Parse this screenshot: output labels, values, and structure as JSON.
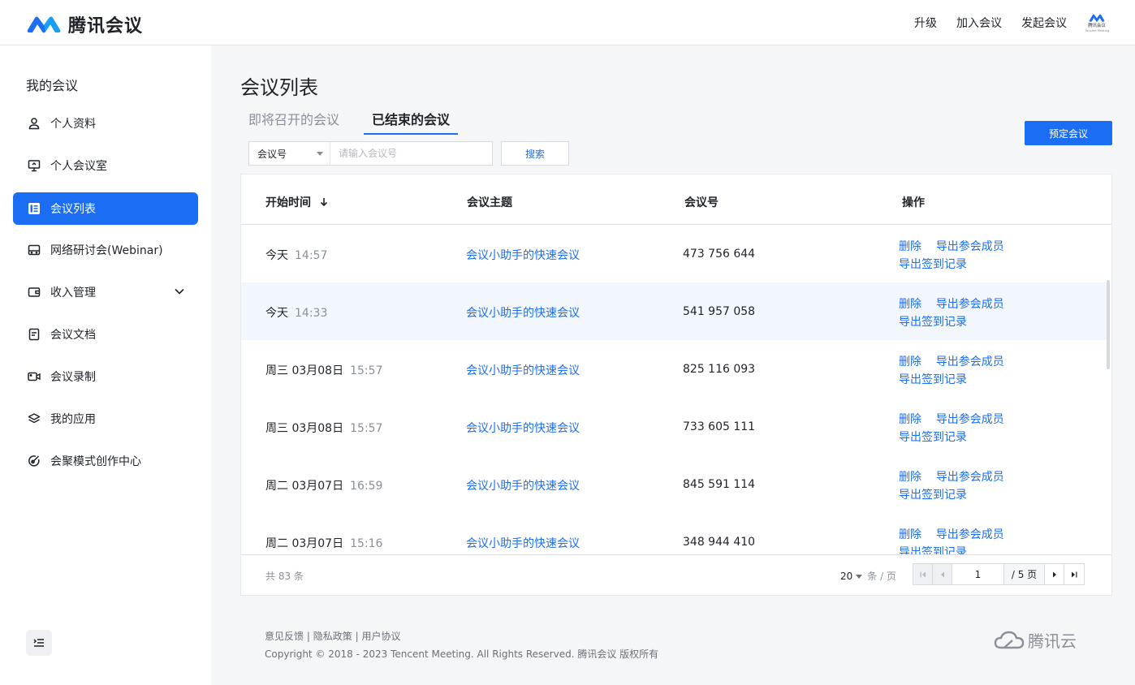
{
  "app": {
    "brand": "腾讯会议",
    "avatar_text": "腾讯会议",
    "avatar_sub": "Tencent Meeting"
  },
  "topnav": {
    "upgrade": "升级",
    "join": "加入会议",
    "start": "发起会议"
  },
  "sidebar": {
    "title": "我的会议",
    "items": [
      {
        "label": "个人资料",
        "icon": "person-icon"
      },
      {
        "label": "个人会议室",
        "icon": "monitor-icon"
      },
      {
        "label": "会议列表",
        "icon": "list-icon"
      },
      {
        "label": "网络研讨会(Webinar)",
        "icon": "webinar-icon"
      },
      {
        "label": "收入管理",
        "icon": "wallet-icon"
      },
      {
        "label": "会议文档",
        "icon": "document-icon"
      },
      {
        "label": "会议录制",
        "icon": "video-icon"
      },
      {
        "label": "我的应用",
        "icon": "layers-icon"
      },
      {
        "label": "会聚模式创作中心",
        "icon": "create-icon"
      }
    ],
    "active_index": 2
  },
  "main": {
    "title": "会议列表",
    "tabs": [
      {
        "label": "即将召开的会议"
      },
      {
        "label": "已结束的会议"
      }
    ],
    "active_tab": 1,
    "book_button": "预定会议",
    "search": {
      "select_value": "会议号",
      "placeholder": "请输入会议号",
      "button": "搜索"
    }
  },
  "table": {
    "headers": {
      "time": "开始时间",
      "topic": "会议主题",
      "number": "会议号",
      "ops": "操作"
    },
    "sort_icon": "arrow-down-icon",
    "rows": [
      {
        "day": "今天",
        "time": "14:57",
        "topic": "会议小助手的快速会议",
        "number": "473 756 644",
        "op_delete": "删除",
        "op_export_members": "导出参会成员",
        "op_export_signin": "导出签到记录"
      },
      {
        "day": "今天",
        "time": "14:33",
        "topic": "会议小助手的快速会议",
        "number": "541 957 058",
        "op_delete": "删除",
        "op_export_members": "导出参会成员",
        "op_export_signin": "导出签到记录"
      },
      {
        "day": "周三 03月08日",
        "time": "15:57",
        "topic": "会议小助手的快速会议",
        "number": "825 116 093",
        "op_delete": "删除",
        "op_export_members": "导出参会成员",
        "op_export_signin": "导出签到记录"
      },
      {
        "day": "周三 03月08日",
        "time": "15:57",
        "topic": "会议小助手的快速会议",
        "number": "733 605 111",
        "op_delete": "删除",
        "op_export_members": "导出参会成员",
        "op_export_signin": "导出签到记录"
      },
      {
        "day": "周二 03月07日",
        "time": "16:59",
        "topic": "会议小助手的快速会议",
        "number": "845 591 114",
        "op_delete": "删除",
        "op_export_members": "导出参会成员",
        "op_export_signin": "导出签到记录"
      },
      {
        "day": "周二 03月07日",
        "time": "15:16",
        "topic": "会议小助手的快速会议",
        "number": "348 944 410",
        "op_delete": "删除",
        "op_export_members": "导出参会成员",
        "op_export_signin": "导出签到记录"
      }
    ],
    "highlighted_row": 1
  },
  "pagination": {
    "total_text": "共 83 条",
    "page_size": "20",
    "page_size_unit": "条 / 页",
    "current_page": "1",
    "total_pages": "/ 5 页"
  },
  "footer": {
    "links": [
      "意见反馈",
      "隐私政策",
      "用户协议"
    ],
    "separator": "|",
    "copyright": "Copyright © 2018 - 2023 Tencent Meeting. All Rights Reserved. 腾讯会议 版权所有",
    "cloud_brand": "腾讯云"
  },
  "colors": {
    "accent": "#1b6ef3",
    "text": "#1f2329",
    "muted": "#8a8f99",
    "row_highlight": "#f2f6fd"
  }
}
